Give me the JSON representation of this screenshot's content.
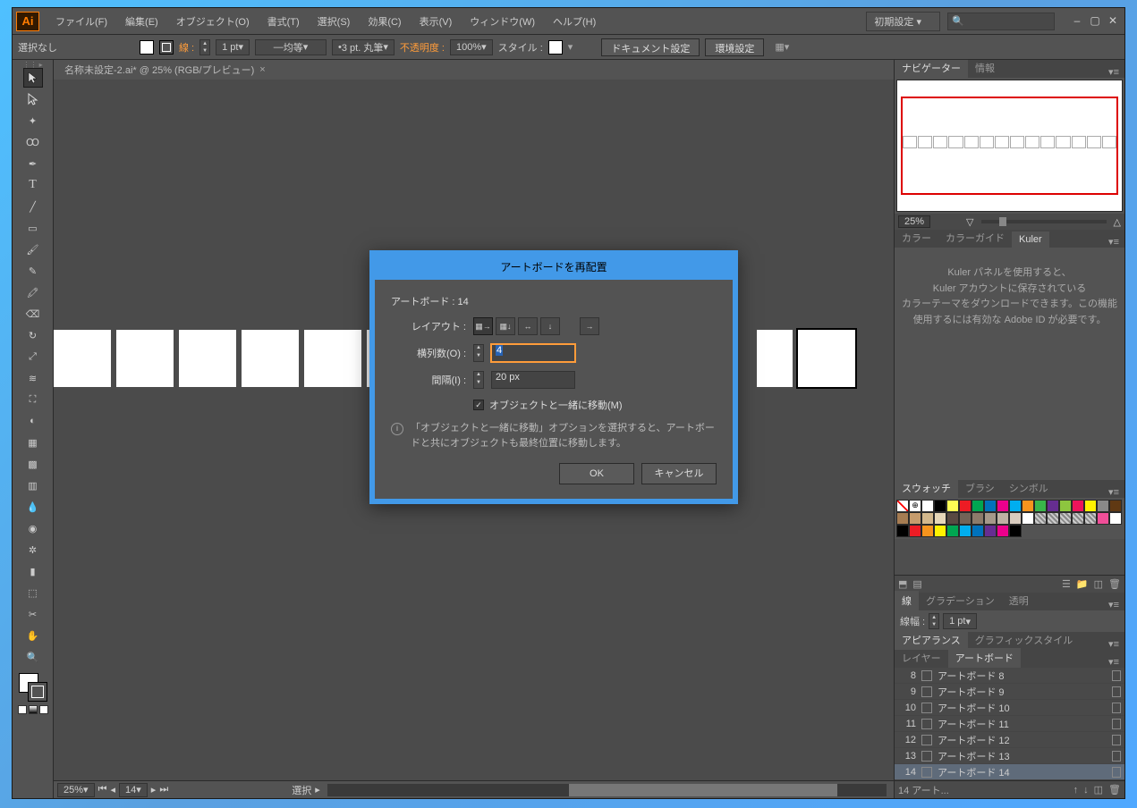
{
  "app": {
    "logo": "Ai"
  },
  "menus": [
    "ファイル(F)",
    "編集(E)",
    "オブジェクト(O)",
    "書式(T)",
    "選択(S)",
    "効果(C)",
    "表示(V)",
    "ウィンドウ(W)",
    "ヘルプ(H)"
  ],
  "workspace_menu": "初期設定",
  "control": {
    "selection_label": "選択なし",
    "stroke_label": "線 :",
    "stroke_weight": "1 pt",
    "stroke_profile": "均等",
    "brush_size": "3 pt. 丸筆",
    "opacity_label": "不透明度 :",
    "opacity": "100%",
    "style_label": "スタイル :",
    "doc_setup": "ドキュメント設定",
    "env_setup": "環境設定"
  },
  "document_tab": "名称未設定-2.ai* @ 25% (RGB/プレビュー)",
  "navigator": {
    "tab1": "ナビゲーター",
    "tab2": "情報",
    "zoom": "25%"
  },
  "color_panel": {
    "t1": "カラー",
    "t2": "カラーガイド",
    "t3": "Kuler",
    "kuler_line1": "Kuler パネルを使用すると、",
    "kuler_line2": "Kuler アカウントに保存されている",
    "kuler_line3": "カラーテーマをダウンロードできます。この機能",
    "kuler_line4": "使用するには有効な Adobe ID が必要です。"
  },
  "swatches_panel": {
    "t1": "スウォッチ",
    "t2": "ブラシ",
    "t3": "シンボル"
  },
  "swatch_colors": [
    "none",
    "registration",
    "#ffffff",
    "#000000",
    "#fefd54",
    "#ed1c24",
    "#00a651",
    "#0072bc",
    "#ec008c",
    "#00aeef",
    "#f7941d",
    "#39b54a",
    "#662d91",
    "#8dc63f",
    "#ed145b",
    "#fff200",
    "#898989",
    "#603913",
    "#a67c52",
    "#c69c6d",
    "#d3b88c",
    "#e6d7b8",
    "#594a42",
    "#736357",
    "#8c7b6b",
    "#a6988a",
    "#bfb1a3",
    "#d9ccbf",
    "#ffffff",
    "#pat1",
    "#pat2",
    "#pat3",
    "#pat4",
    "#pat5",
    "#f04e98",
    "#fff",
    "#000",
    "#ed1c24",
    "#f7941d",
    "#fff200",
    "#00a651",
    "#00aeef",
    "#0072bc",
    "#662d91",
    "#ec008c",
    "#000000"
  ],
  "stroke_panel": {
    "t1": "線",
    "t2": "グラデーション",
    "t3": "透明",
    "label": "線幅 :",
    "value": "1 pt"
  },
  "appearance_panel": {
    "t1": "アピアランス",
    "t2": "グラフィックスタイル"
  },
  "layers_panel": {
    "t1": "レイヤー",
    "t2": "アートボード"
  },
  "artboards": [
    {
      "num": "8",
      "name": "アートボード 8"
    },
    {
      "num": "9",
      "name": "アートボード 9"
    },
    {
      "num": "10",
      "name": "アートボード 10"
    },
    {
      "num": "11",
      "name": "アートボード 11"
    },
    {
      "num": "12",
      "name": "アートボード 12"
    },
    {
      "num": "13",
      "name": "アートボード 13"
    },
    {
      "num": "14",
      "name": "アートボード 14"
    }
  ],
  "artboard_footer": "14 アート...",
  "status": {
    "zoom": "25%",
    "artboard_num": "14",
    "center": "選択"
  },
  "dialog": {
    "title": "アートボードを再配置",
    "count_label": "アートボード : 14",
    "layout_label": "レイアウト :",
    "cols_label": "横列数(O) :",
    "cols_value": "4",
    "spacing_label": "間隔(I) :",
    "spacing_value": "20 px",
    "move_obj": "オブジェクトと一緒に移動(M)",
    "info": "「オブジェクトと一緒に移動」オプションを選択すると、アートボードと共にオブジェクトも最終位置に移動します。",
    "ok": "OK",
    "cancel": "キャンセル"
  }
}
